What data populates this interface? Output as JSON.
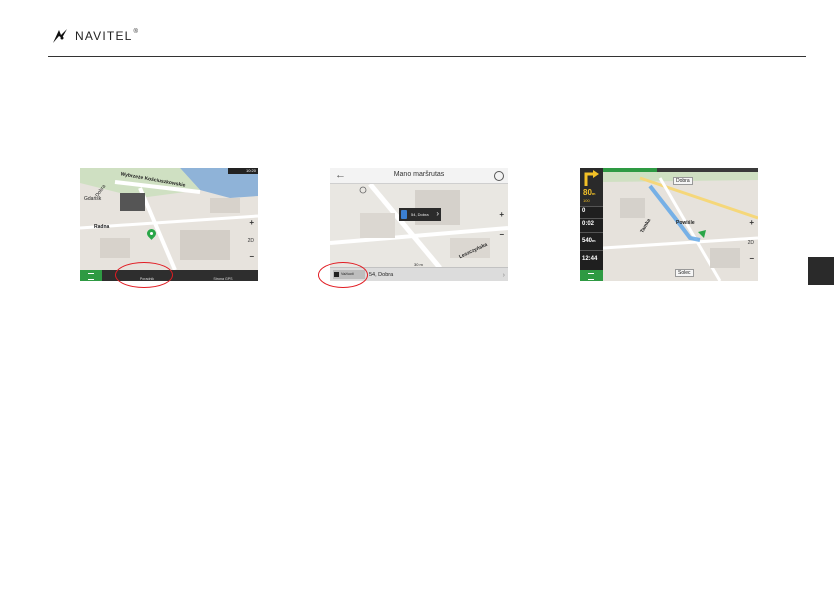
{
  "header": {
    "brand": "NAVITEL",
    "reg_mark": "®"
  },
  "shot1": {
    "status_time": "10:20",
    "labels": {
      "street1": "Wybrzeże Kościuszkowskie",
      "street2": "Radna",
      "street3": "Dobra",
      "place1": "Gdańsk"
    },
    "bottom_buttons": [
      "Poradnik",
      "Strona GPS"
    ],
    "zoom_plus": "+",
    "zoom_minus": "−",
    "mode": "2D"
  },
  "shot2": {
    "title": "Mano maršrutas",
    "popup_text": "54, Dobra",
    "via_button": "Važiuoti",
    "address": "54, Dobra",
    "street": "Leszczyńska",
    "scale": "30 m",
    "zoom_plus": "+",
    "zoom_minus": "−"
  },
  "shot3": {
    "turn_distance": "80",
    "turn_distance_unit": "m",
    "next_distance": "100",
    "speed": "0",
    "time_remaining": "0:02",
    "distance_remaining": "540",
    "distance_unit": "m",
    "clock": "12:44",
    "street_top": "Dobra",
    "street_bottom": "Solec",
    "street_left": "Tamka",
    "street_mid": "Powiśle",
    "route_progress": 0.35,
    "zoom_plus": "+",
    "zoom_minus": "−",
    "mode": "2D"
  },
  "colors": {
    "navitel_green": "#2e9a43",
    "highlight_red": "#e11b22",
    "river_blue": "#8fb3d8",
    "route_blue": "#5aa4e8"
  }
}
